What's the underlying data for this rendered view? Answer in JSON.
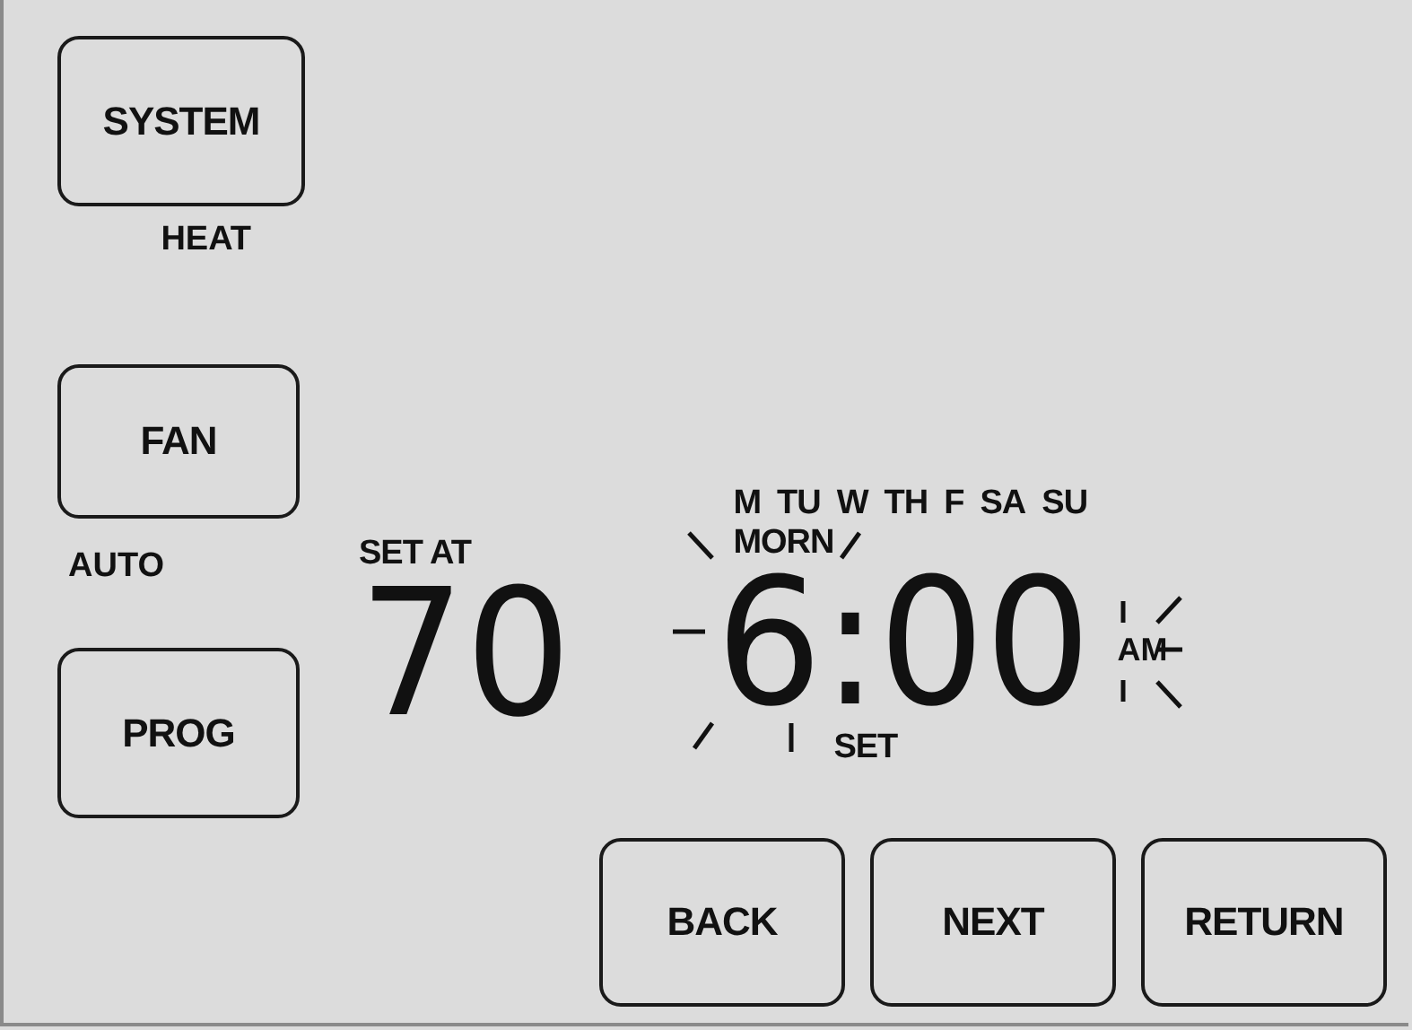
{
  "mode_buttons": [
    {
      "label": "SYSTEM",
      "status": "HEAT"
    },
    {
      "label": "FAN",
      "status": "AUTO"
    },
    {
      "label": "PROG"
    }
  ],
  "setpoint": {
    "label": "SET AT",
    "value": "70"
  },
  "schedule": {
    "days": [
      "M",
      "TU",
      "W",
      "TH",
      "F",
      "SA",
      "SU"
    ],
    "period": "MORN",
    "time": "6:00",
    "meridiem": "AM",
    "caption": "SET",
    "flashing": true
  },
  "nav_buttons": [
    "BACK",
    "NEXT",
    "RETURN"
  ]
}
